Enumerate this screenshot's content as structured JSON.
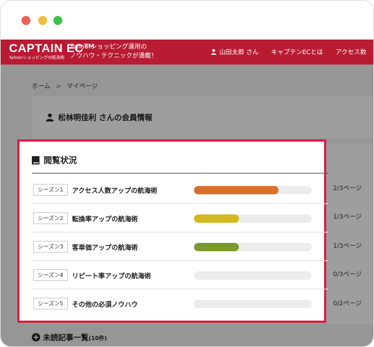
{
  "header": {
    "logo_main": "CAPTAIN EC™",
    "logo_sub": "Yahoo!ショッピングの航海術",
    "tagline_line1": "Yahoo!ショッピング運用の",
    "tagline_line2": "ノウハウ・テクニックが満載！",
    "user_name": "山田太郎 さん",
    "nav_about": "キャプテンECとは",
    "nav_access": "アクセス数"
  },
  "breadcrumb": {
    "home": "ホーム",
    "separator": ">",
    "current": "マイページ"
  },
  "member": {
    "title": "松林明佳利 さんの会員情報"
  },
  "progress": {
    "title": "閲覧状況",
    "rows": [
      {
        "season": "シーズン1",
        "title": "アクセス人数アップの航海術",
        "pages": "2/3ページ",
        "progress": 0.72,
        "color": "#d9702a"
      },
      {
        "season": "シーズン2",
        "title": "転換率アップの航海術",
        "pages": "1/3ページ",
        "progress": 0.38,
        "color": "#d3b81f"
      },
      {
        "season": "シーズン3",
        "title": "客単価アップの航海術",
        "pages": "1/3ページ",
        "progress": 0.38,
        "color": "#7a9a2a"
      },
      {
        "season": "シーズン4",
        "title": "リピート率アップの航海術",
        "pages": "0/3ページ",
        "progress": 0,
        "color": "#cccccc"
      },
      {
        "season": "シーズン5",
        "title": "その他の必須ノウハウ",
        "pages": "0/2ページ",
        "progress": 0,
        "color": "#cccccc"
      }
    ]
  },
  "unread": {
    "label": "未読記事一覧",
    "count": "(10件)"
  },
  "colors": {
    "brand": "#b81b32",
    "highlight": "#e0183f"
  },
  "icons": {
    "user": "user-icon",
    "person": "person-icon",
    "book": "book-icon",
    "plus": "plus-circle-icon"
  }
}
